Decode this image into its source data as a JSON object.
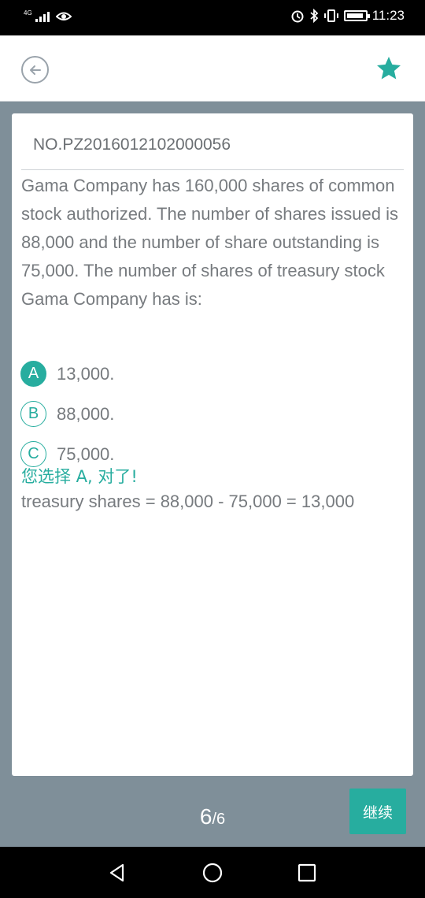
{
  "status_bar": {
    "network": "4G",
    "time": "11:23",
    "icons": [
      "signal-icon",
      "eye-icon",
      "alarm-icon",
      "bluetooth-icon",
      "vibrate-icon",
      "battery-icon"
    ]
  },
  "header": {
    "back_icon": "arrow-left-circle-icon",
    "favorite_icon": "star-icon",
    "accent_color": "#27ad9f"
  },
  "question": {
    "number": "NO.PZ2016012102000056",
    "text": "Gama Company has 160,000 shares of common stock authorized. The number of shares issued is 88,000 and the number of share outstanding is 75,000. The number of shares of treasury stock Gama Company has is:",
    "options": [
      {
        "letter": "A",
        "text": "13,000.",
        "selected": true
      },
      {
        "letter": "B",
        "text": "88,000.",
        "selected": false
      },
      {
        "letter": "C",
        "text": "75,000.",
        "selected": false
      }
    ],
    "result": "您选择 A, 对了!",
    "explanation": "treasury shares = 88,000 - 75,000 = 13,000"
  },
  "footer": {
    "current_page": "6",
    "total_pages": "/6",
    "continue_label": "继续"
  },
  "nav_bar": {
    "icons": [
      "back-triangle-icon",
      "home-circle-icon",
      "recents-square-icon"
    ]
  }
}
